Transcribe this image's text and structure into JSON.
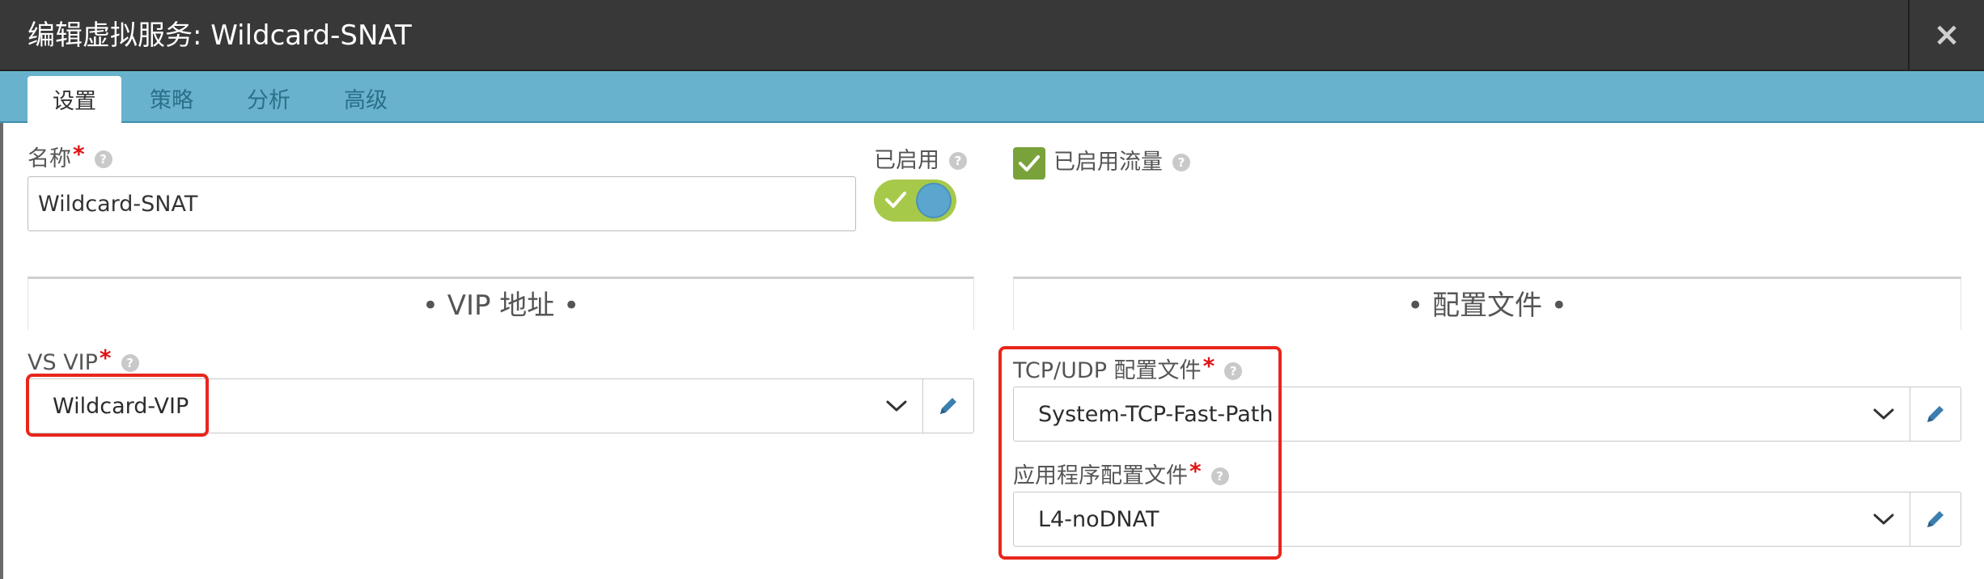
{
  "dialog": {
    "title": "编辑虚拟服务: Wildcard-SNAT",
    "close_glyph": "×"
  },
  "tabs": [
    {
      "label": "设置",
      "active": true
    },
    {
      "label": "策略",
      "active": false
    },
    {
      "label": "分析",
      "active": false
    },
    {
      "label": "高级",
      "active": false
    }
  ],
  "form": {
    "name_label": "名称",
    "required_mark": "*",
    "help_glyph": "?",
    "name_value": "Wildcard-SNAT",
    "enabled_label": "已启用",
    "enabled_state": true,
    "traffic_enabled_label": "已启用流量",
    "traffic_enabled_checked": true
  },
  "sections": {
    "vip_title": "• VIP 地址 •",
    "profiles_title": "• 配置文件 •"
  },
  "vip": {
    "label": "VS VIP",
    "value": "Wildcard-VIP"
  },
  "profiles": {
    "tcp_udp_label": "TCP/UDP 配置文件",
    "tcp_udp_value": "System-TCP-Fast-Path",
    "app_label": "应用程序配置文件",
    "app_value": "L4-noDNAT"
  },
  "colors": {
    "titlebar": "#383838",
    "tabstrip": "#69b2cd",
    "toggle_on": "#a7c94a",
    "checkbox": "#7aa23b",
    "highlight": "#e8261b",
    "required": "#e01414",
    "edit_icon": "#3b7fb0"
  },
  "icons": {
    "close": "close-icon",
    "help": "help-icon",
    "check": "check-icon",
    "chevron": "chevron-down-icon",
    "edit": "pencil-icon"
  }
}
